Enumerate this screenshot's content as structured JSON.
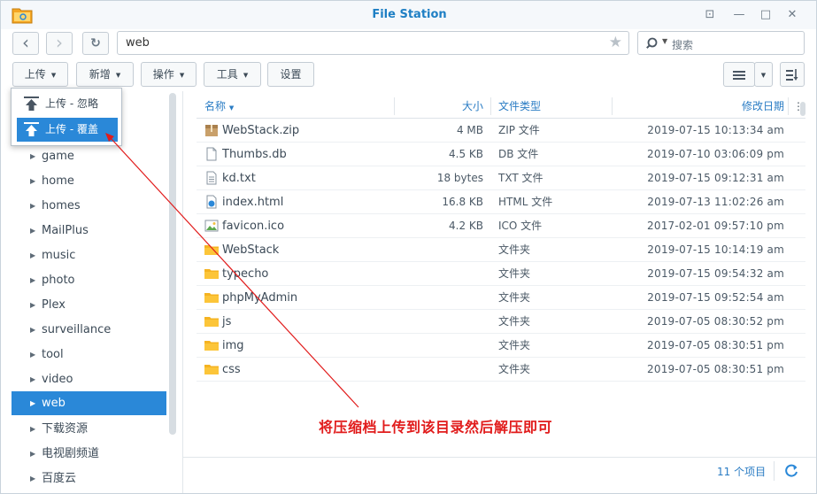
{
  "window": {
    "title": "File Station",
    "controls": {
      "pin": "⊡",
      "minimize": "—",
      "maximize": "□",
      "close": "✕"
    }
  },
  "nav": {
    "back": "‹",
    "forward": "›",
    "refresh": "↻",
    "path": "web",
    "search_placeholder": "搜索"
  },
  "toolbar": {
    "upload": "上传",
    "create": "新增",
    "action": "操作",
    "tools": "工具",
    "settings": "设置"
  },
  "upload_menu": {
    "items": [
      {
        "label": "上传 - 忽略",
        "icon": "upload-arrow-icon"
      },
      {
        "label": "上传 - 覆盖",
        "icon": "upload-overwrite-icon"
      }
    ]
  },
  "tree": {
    "items": [
      {
        "label": "game"
      },
      {
        "label": "home"
      },
      {
        "label": "homes"
      },
      {
        "label": "MailPlus"
      },
      {
        "label": "music"
      },
      {
        "label": "photo"
      },
      {
        "label": "Plex"
      },
      {
        "label": "surveillance"
      },
      {
        "label": "tool"
      },
      {
        "label": "video"
      },
      {
        "label": "web",
        "selected": true
      },
      {
        "label": "下载资源"
      },
      {
        "label": "电视剧频道"
      },
      {
        "label": "百度云"
      }
    ]
  },
  "list": {
    "headers": {
      "name": "名称",
      "size": "大小",
      "type": "文件类型",
      "modified": "修改日期",
      "more": "⋮"
    },
    "rows": [
      {
        "name": "WebStack.zip",
        "size": "4 MB",
        "type": "ZIP 文件",
        "modified": "2019-07-15 10:13:34 am",
        "icon": "zip-file-icon"
      },
      {
        "name": "Thumbs.db",
        "size": "4.5 KB",
        "type": "DB 文件",
        "modified": "2019-07-10 03:06:09 pm",
        "icon": "file-icon"
      },
      {
        "name": "kd.txt",
        "size": "18 bytes",
        "type": "TXT 文件",
        "modified": "2019-07-15 09:12:31 am",
        "icon": "text-file-icon"
      },
      {
        "name": "index.html",
        "size": "16.8 KB",
        "type": "HTML 文件",
        "modified": "2019-07-13 11:02:26 am",
        "icon": "html-file-icon"
      },
      {
        "name": "favicon.ico",
        "size": "4.2 KB",
        "type": "ICO 文件",
        "modified": "2017-02-01 09:57:10 pm",
        "icon": "image-file-icon"
      },
      {
        "name": "WebStack",
        "size": "",
        "type": "文件夹",
        "modified": "2019-07-15 10:14:19 am",
        "icon": "folder-icon"
      },
      {
        "name": "typecho",
        "size": "",
        "type": "文件夹",
        "modified": "2019-07-15 09:54:32 am",
        "icon": "folder-icon"
      },
      {
        "name": "phpMyAdmin",
        "size": "",
        "type": "文件夹",
        "modified": "2019-07-15 09:52:54 am",
        "icon": "folder-icon"
      },
      {
        "name": "js",
        "size": "",
        "type": "文件夹",
        "modified": "2019-07-05 08:30:52 pm",
        "icon": "folder-icon"
      },
      {
        "name": "img",
        "size": "",
        "type": "文件夹",
        "modified": "2019-07-05 08:30:51 pm",
        "icon": "folder-icon"
      },
      {
        "name": "css",
        "size": "",
        "type": "文件夹",
        "modified": "2019-07-05 08:30:51 pm",
        "icon": "folder-icon"
      }
    ]
  },
  "footer": {
    "count": "11 个项目"
  },
  "annotation": {
    "text": "将压缩档上传到该目录然后解压即可",
    "color": "#e11c1c"
  },
  "colors": {
    "accent": "#2a88d8",
    "title": "#1e7fc4",
    "folder": "#f5b321"
  }
}
